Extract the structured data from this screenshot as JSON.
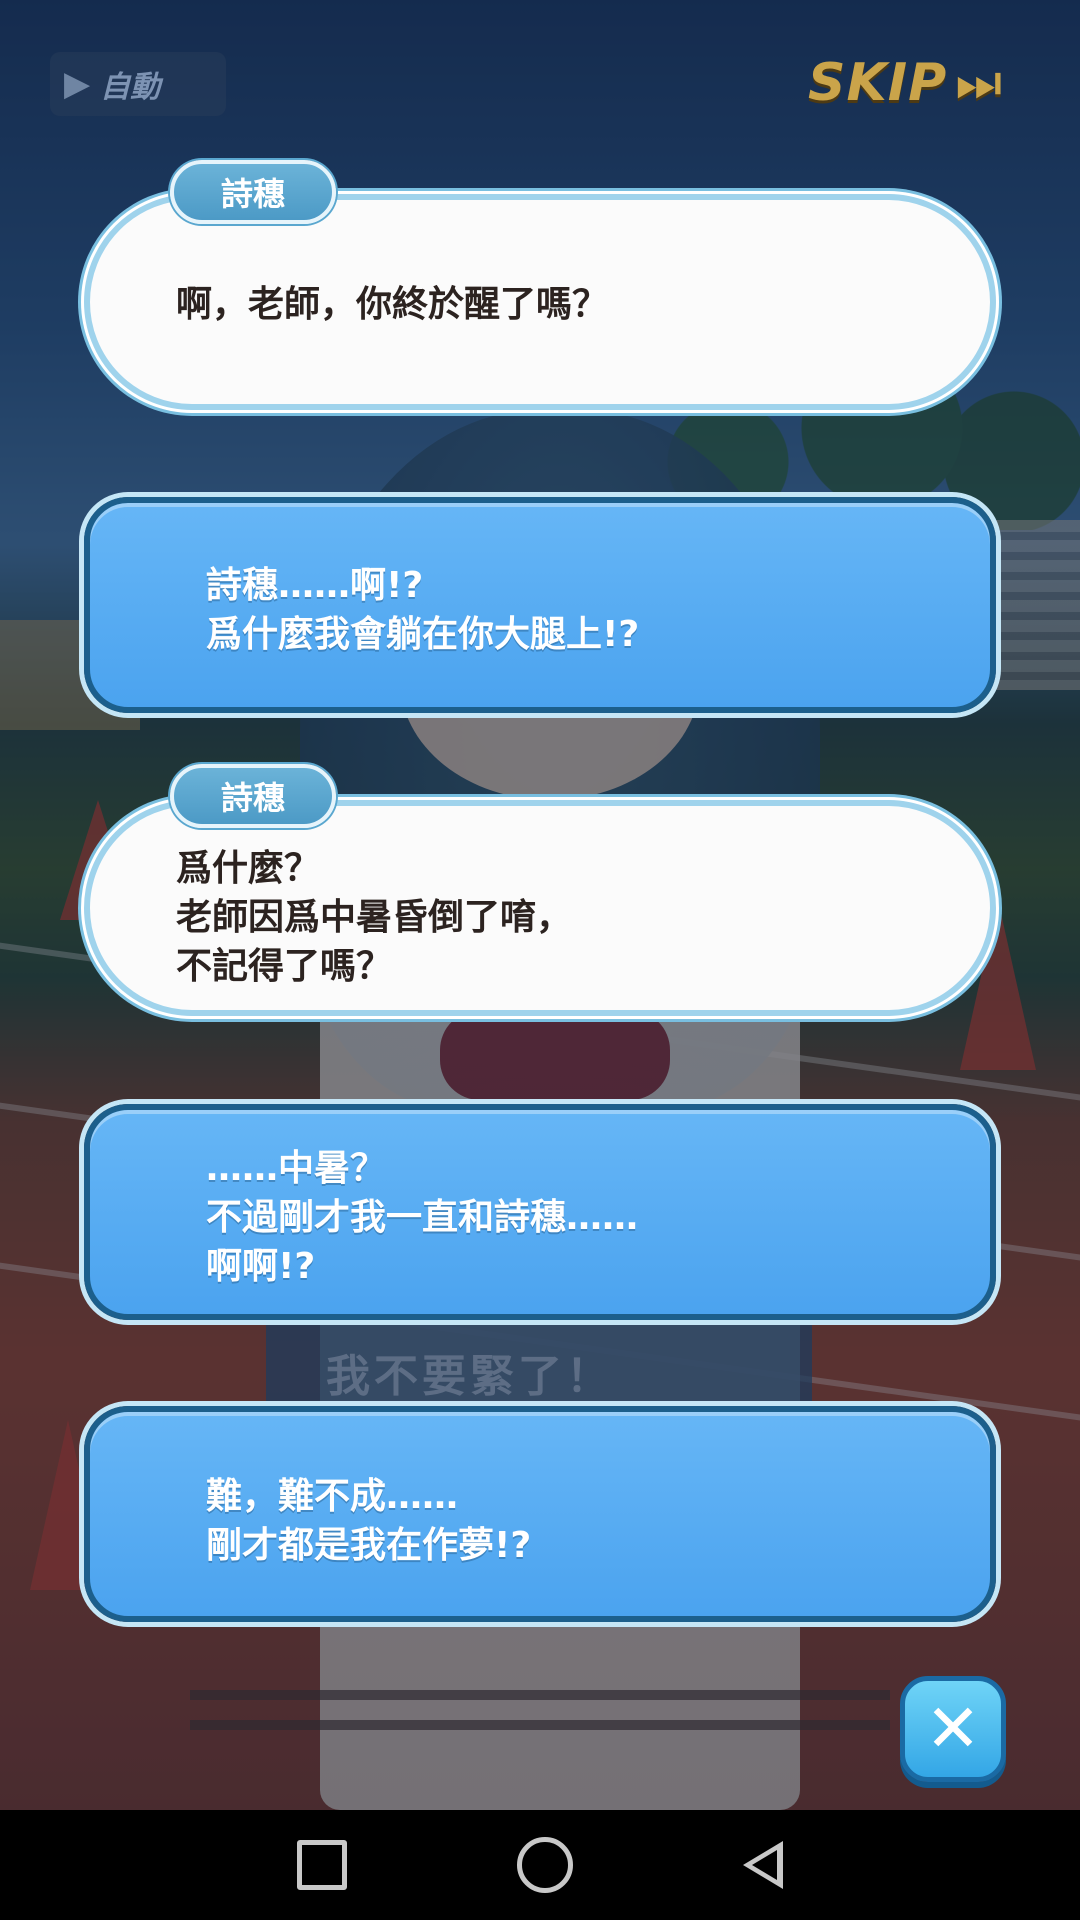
{
  "controls": {
    "auto_label": "自動",
    "skip_label": "SKIP"
  },
  "background": {
    "sign_text": "我不要緊了！"
  },
  "dialogue": [
    {
      "speaker": "詩穗",
      "style": "white",
      "lines": [
        "啊，老師，你終於醒了嗎？"
      ]
    },
    {
      "speaker": "",
      "style": "blue",
      "lines": [
        "詩穗……啊!?",
        "爲什麼我會躺在你大腿上!?"
      ]
    },
    {
      "speaker": "詩穗",
      "style": "white",
      "lines": [
        "爲什麼？",
        "老師因爲中暑昏倒了唷，",
        "不記得了嗎？"
      ]
    },
    {
      "speaker": "",
      "style": "blue",
      "lines": [
        "……中暑？",
        "不過剛才我一直和詩穗……",
        "啊啊!?"
      ]
    },
    {
      "speaker": "",
      "style": "blue",
      "lines": [
        "難，難不成……",
        "剛才都是我在作夢!?"
      ]
    }
  ],
  "colors": {
    "bubble_white_bg": "#fbfbfb",
    "bubble_blue_bg": "#4ba3ef",
    "name_tag_bg": "#5aa7cf",
    "skip_gold": "#caa44a"
  }
}
